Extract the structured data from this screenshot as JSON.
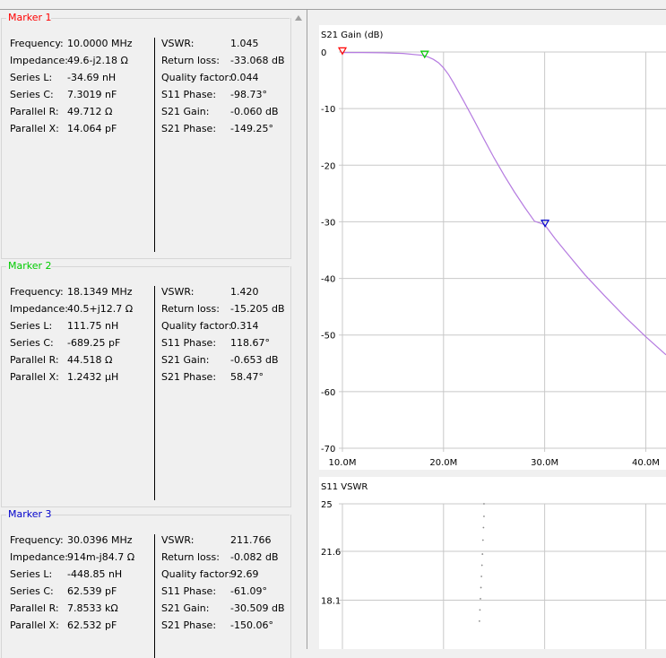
{
  "markers": [
    {
      "title": "Marker 1",
      "color": "#ff0000",
      "left_rows": [
        {
          "label": "Frequency:",
          "value": "10.0000 MHz"
        },
        {
          "label": "Impedance:",
          "value": "49.6-j2.18 Ω"
        },
        {
          "label": "Series L:",
          "value": "-34.69 nH"
        },
        {
          "label": "Series C:",
          "value": "7.3019 nF"
        },
        {
          "label": "Parallel R:",
          "value": "49.712 Ω"
        },
        {
          "label": "Parallel X:",
          "value": "14.064 pF"
        }
      ],
      "right_rows": [
        {
          "label": "VSWR:",
          "value": "1.045"
        },
        {
          "label": "Return loss:",
          "value": "-33.068 dB"
        },
        {
          "label": "Quality factor:",
          "value": "0.044"
        },
        {
          "label": "S11 Phase:",
          "value": "-98.73°"
        },
        {
          "label": "S21 Gain:",
          "value": "-0.060 dB"
        },
        {
          "label": "S21 Phase:",
          "value": "-149.25°"
        }
      ]
    },
    {
      "title": "Marker 2",
      "color": "#00cc00",
      "left_rows": [
        {
          "label": "Frequency:",
          "value": "18.1349 MHz"
        },
        {
          "label": "Impedance:",
          "value": "40.5+j12.7 Ω"
        },
        {
          "label": "Series L:",
          "value": "111.75 nH"
        },
        {
          "label": "Series C:",
          "value": "-689.25 pF"
        },
        {
          "label": "Parallel R:",
          "value": "44.518 Ω"
        },
        {
          "label": "Parallel X:",
          "value": "1.2432 µH"
        }
      ],
      "right_rows": [
        {
          "label": "VSWR:",
          "value": "1.420"
        },
        {
          "label": "Return loss:",
          "value": "-15.205 dB"
        },
        {
          "label": "Quality factor:",
          "value": "0.314"
        },
        {
          "label": "S11 Phase:",
          "value": "118.67°"
        },
        {
          "label": "S21 Gain:",
          "value": "-0.653 dB"
        },
        {
          "label": "S21 Phase:",
          "value": "58.47°"
        }
      ]
    },
    {
      "title": "Marker 3",
      "color": "#0000cc",
      "left_rows": [
        {
          "label": "Frequency:",
          "value": "30.0396 MHz"
        },
        {
          "label": "Impedance:",
          "value": "914m-j84.7 Ω"
        },
        {
          "label": "Series L:",
          "value": "-448.85 nH"
        },
        {
          "label": "Series C:",
          "value": "62.539 pF"
        },
        {
          "label": "Parallel R:",
          "value": "7.8533 kΩ"
        },
        {
          "label": "Parallel X:",
          "value": "62.532 pF"
        }
      ],
      "right_rows": [
        {
          "label": "VSWR:",
          "value": "211.766"
        },
        {
          "label": "Return loss:",
          "value": "-0.082 dB"
        },
        {
          "label": "Quality factor:",
          "value": "92.69"
        },
        {
          "label": "S11 Phase:",
          "value": "-61.09°"
        },
        {
          "label": "S21 Gain:",
          "value": "-30.509 dB"
        },
        {
          "label": "S21 Phase:",
          "value": "-150.06°"
        }
      ]
    }
  ],
  "chart_data": [
    {
      "type": "line",
      "title": "S21 Gain (dB)",
      "xlim": [
        10,
        42
      ],
      "ylim": [
        -70,
        0
      ],
      "x_ticks": [
        10,
        20,
        30,
        40
      ],
      "x_tick_labels": [
        "10.0M",
        "20.0M",
        "30.0M",
        "40.0M"
      ],
      "y_ticks": [
        0,
        -10,
        -20,
        -30,
        -40,
        -50,
        -60,
        -70
      ],
      "y_tick_labels": [
        "0",
        "-10",
        "-20",
        "-30",
        "-40",
        "-50",
        "-60",
        "-70"
      ],
      "grid": true,
      "line_color": "#b57be0",
      "series": [
        {
          "x": [
            10.0,
            12.0,
            14.0,
            16.0,
            18.0,
            18.5,
            19.0,
            19.5,
            20.0,
            20.5,
            21.0,
            22.0,
            23.0,
            24.0,
            25.0,
            26.0,
            27.0,
            28.0,
            29.0,
            30.0,
            31.0,
            32.0,
            34.0,
            36.0,
            38.0,
            40.0,
            42.0
          ],
          "y": [
            -0.1,
            -0.1,
            -0.15,
            -0.25,
            -0.6,
            -0.9,
            -1.3,
            -1.9,
            -2.8,
            -4.0,
            -5.5,
            -8.7,
            -12.0,
            -15.4,
            -18.7,
            -21.8,
            -24.7,
            -27.4,
            -29.9,
            -30.5,
            -32.9,
            -35.1,
            -39.4,
            -43.2,
            -46.9,
            -50.3,
            -53.5
          ]
        }
      ],
      "markers": [
        {
          "x": 10.0,
          "y": -0.06,
          "color": "#ff0000"
        },
        {
          "x": 18.1349,
          "y": -0.653,
          "color": "#00cc00"
        },
        {
          "x": 30.0396,
          "y": -30.509,
          "color": "#0000cc"
        }
      ]
    },
    {
      "type": "scatter",
      "title": "S11 VSWR",
      "ylim": [
        14.6,
        25
      ],
      "y_ticks": [
        25,
        21.6,
        18.1
      ],
      "y_tick_labels": [
        "25",
        "21.6",
        "18.1"
      ],
      "grid": true,
      "point_color": "#888888",
      "points": [
        {
          "x": 24.0,
          "y": 25.0
        },
        {
          "x": 24.0,
          "y": 24.1
        },
        {
          "x": 23.95,
          "y": 23.3
        },
        {
          "x": 23.9,
          "y": 22.4
        },
        {
          "x": 23.85,
          "y": 21.4
        },
        {
          "x": 23.8,
          "y": 20.6
        },
        {
          "x": 23.75,
          "y": 19.8
        },
        {
          "x": 23.7,
          "y": 19.0
        },
        {
          "x": 23.65,
          "y": 18.2
        },
        {
          "x": 23.6,
          "y": 17.4
        },
        {
          "x": 23.55,
          "y": 16.6
        }
      ]
    }
  ]
}
